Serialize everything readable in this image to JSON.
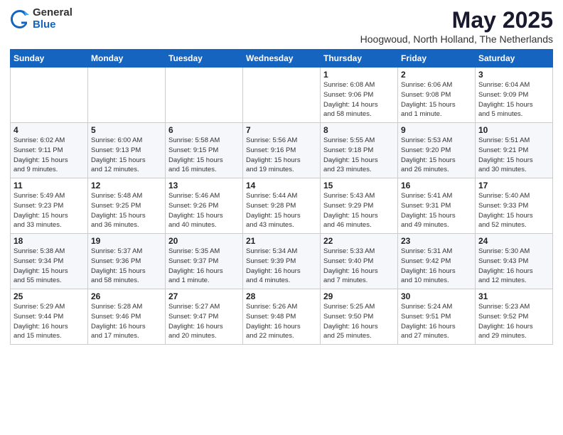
{
  "logo": {
    "general": "General",
    "blue": "Blue"
  },
  "title": {
    "month": "May 2025",
    "location": "Hoogwoud, North Holland, The Netherlands"
  },
  "weekdays": [
    "Sunday",
    "Monday",
    "Tuesday",
    "Wednesday",
    "Thursday",
    "Friday",
    "Saturday"
  ],
  "weeks": [
    [
      {
        "day": "",
        "info": ""
      },
      {
        "day": "",
        "info": ""
      },
      {
        "day": "",
        "info": ""
      },
      {
        "day": "",
        "info": ""
      },
      {
        "day": "1",
        "info": "Sunrise: 6:08 AM\nSunset: 9:06 PM\nDaylight: 14 hours\nand 58 minutes."
      },
      {
        "day": "2",
        "info": "Sunrise: 6:06 AM\nSunset: 9:08 PM\nDaylight: 15 hours\nand 1 minute."
      },
      {
        "day": "3",
        "info": "Sunrise: 6:04 AM\nSunset: 9:09 PM\nDaylight: 15 hours\nand 5 minutes."
      }
    ],
    [
      {
        "day": "4",
        "info": "Sunrise: 6:02 AM\nSunset: 9:11 PM\nDaylight: 15 hours\nand 9 minutes."
      },
      {
        "day": "5",
        "info": "Sunrise: 6:00 AM\nSunset: 9:13 PM\nDaylight: 15 hours\nand 12 minutes."
      },
      {
        "day": "6",
        "info": "Sunrise: 5:58 AM\nSunset: 9:15 PM\nDaylight: 15 hours\nand 16 minutes."
      },
      {
        "day": "7",
        "info": "Sunrise: 5:56 AM\nSunset: 9:16 PM\nDaylight: 15 hours\nand 19 minutes."
      },
      {
        "day": "8",
        "info": "Sunrise: 5:55 AM\nSunset: 9:18 PM\nDaylight: 15 hours\nand 23 minutes."
      },
      {
        "day": "9",
        "info": "Sunrise: 5:53 AM\nSunset: 9:20 PM\nDaylight: 15 hours\nand 26 minutes."
      },
      {
        "day": "10",
        "info": "Sunrise: 5:51 AM\nSunset: 9:21 PM\nDaylight: 15 hours\nand 30 minutes."
      }
    ],
    [
      {
        "day": "11",
        "info": "Sunrise: 5:49 AM\nSunset: 9:23 PM\nDaylight: 15 hours\nand 33 minutes."
      },
      {
        "day": "12",
        "info": "Sunrise: 5:48 AM\nSunset: 9:25 PM\nDaylight: 15 hours\nand 36 minutes."
      },
      {
        "day": "13",
        "info": "Sunrise: 5:46 AM\nSunset: 9:26 PM\nDaylight: 15 hours\nand 40 minutes."
      },
      {
        "day": "14",
        "info": "Sunrise: 5:44 AM\nSunset: 9:28 PM\nDaylight: 15 hours\nand 43 minutes."
      },
      {
        "day": "15",
        "info": "Sunrise: 5:43 AM\nSunset: 9:29 PM\nDaylight: 15 hours\nand 46 minutes."
      },
      {
        "day": "16",
        "info": "Sunrise: 5:41 AM\nSunset: 9:31 PM\nDaylight: 15 hours\nand 49 minutes."
      },
      {
        "day": "17",
        "info": "Sunrise: 5:40 AM\nSunset: 9:33 PM\nDaylight: 15 hours\nand 52 minutes."
      }
    ],
    [
      {
        "day": "18",
        "info": "Sunrise: 5:38 AM\nSunset: 9:34 PM\nDaylight: 15 hours\nand 55 minutes."
      },
      {
        "day": "19",
        "info": "Sunrise: 5:37 AM\nSunset: 9:36 PM\nDaylight: 15 hours\nand 58 minutes."
      },
      {
        "day": "20",
        "info": "Sunrise: 5:35 AM\nSunset: 9:37 PM\nDaylight: 16 hours\nand 1 minute."
      },
      {
        "day": "21",
        "info": "Sunrise: 5:34 AM\nSunset: 9:39 PM\nDaylight: 16 hours\nand 4 minutes."
      },
      {
        "day": "22",
        "info": "Sunrise: 5:33 AM\nSunset: 9:40 PM\nDaylight: 16 hours\nand 7 minutes."
      },
      {
        "day": "23",
        "info": "Sunrise: 5:31 AM\nSunset: 9:42 PM\nDaylight: 16 hours\nand 10 minutes."
      },
      {
        "day": "24",
        "info": "Sunrise: 5:30 AM\nSunset: 9:43 PM\nDaylight: 16 hours\nand 12 minutes."
      }
    ],
    [
      {
        "day": "25",
        "info": "Sunrise: 5:29 AM\nSunset: 9:44 PM\nDaylight: 16 hours\nand 15 minutes."
      },
      {
        "day": "26",
        "info": "Sunrise: 5:28 AM\nSunset: 9:46 PM\nDaylight: 16 hours\nand 17 minutes."
      },
      {
        "day": "27",
        "info": "Sunrise: 5:27 AM\nSunset: 9:47 PM\nDaylight: 16 hours\nand 20 minutes."
      },
      {
        "day": "28",
        "info": "Sunrise: 5:26 AM\nSunset: 9:48 PM\nDaylight: 16 hours\nand 22 minutes."
      },
      {
        "day": "29",
        "info": "Sunrise: 5:25 AM\nSunset: 9:50 PM\nDaylight: 16 hours\nand 25 minutes."
      },
      {
        "day": "30",
        "info": "Sunrise: 5:24 AM\nSunset: 9:51 PM\nDaylight: 16 hours\nand 27 minutes."
      },
      {
        "day": "31",
        "info": "Sunrise: 5:23 AM\nSunset: 9:52 PM\nDaylight: 16 hours\nand 29 minutes."
      }
    ]
  ]
}
